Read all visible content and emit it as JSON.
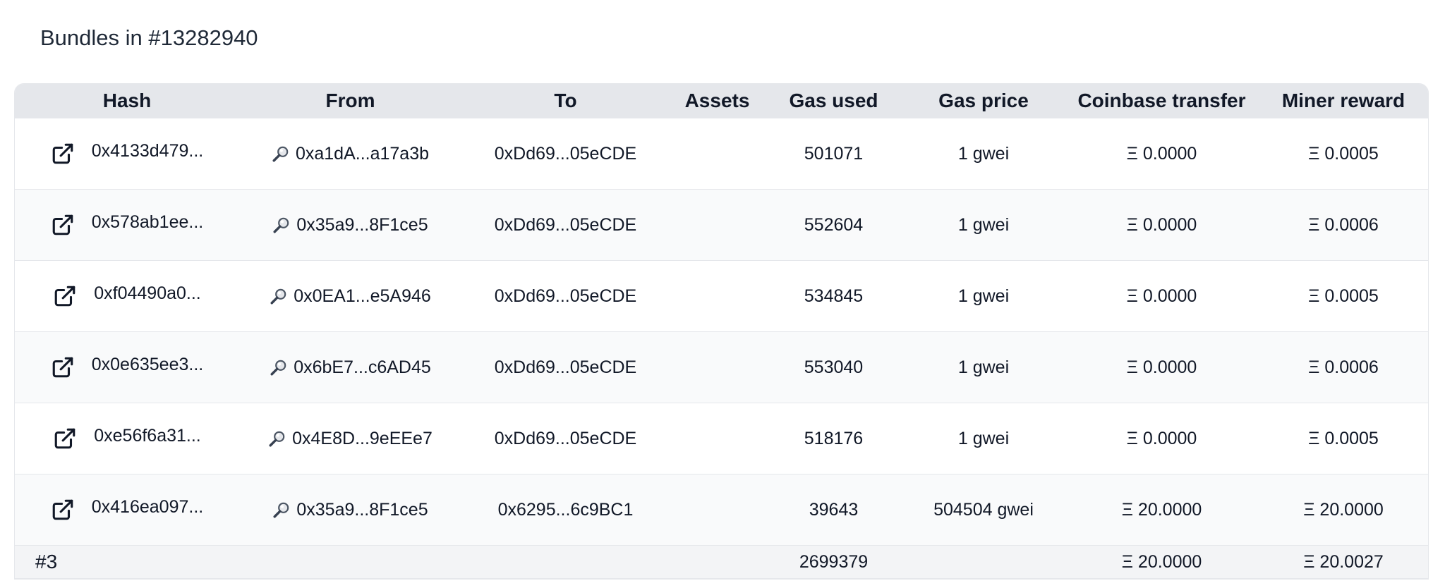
{
  "page": {
    "title": "Bundles in #13282940"
  },
  "table": {
    "headers": {
      "hash": "Hash",
      "from": "From",
      "to": "To",
      "assets": "Assets",
      "gas_used": "Gas used",
      "gas_price": "Gas price",
      "coinbase_transfer": "Coinbase transfer",
      "miner_reward": "Miner reward"
    },
    "rows": [
      {
        "hash": "0x4133d479...",
        "from": "0xa1dA...a17a3b",
        "to": "0xDd69...05eCDE",
        "assets": "",
        "gas_used": "501071",
        "gas_price": "1 gwei",
        "coinbase_transfer": "Ξ 0.0000",
        "miner_reward": "Ξ 0.0005"
      },
      {
        "hash": "0x578ab1ee...",
        "from": "0x35a9...8F1ce5",
        "to": "0xDd69...05eCDE",
        "assets": "",
        "gas_used": "552604",
        "gas_price": "1 gwei",
        "coinbase_transfer": "Ξ 0.0000",
        "miner_reward": "Ξ 0.0006"
      },
      {
        "hash": "0xf04490a0...",
        "from": "0x0EA1...e5A946",
        "to": "0xDd69...05eCDE",
        "assets": "",
        "gas_used": "534845",
        "gas_price": "1 gwei",
        "coinbase_transfer": "Ξ 0.0000",
        "miner_reward": "Ξ 0.0005"
      },
      {
        "hash": "0x0e635ee3...",
        "from": "0x6bE7...c6AD45",
        "to": "0xDd69...05eCDE",
        "assets": "",
        "gas_used": "553040",
        "gas_price": "1 gwei",
        "coinbase_transfer": "Ξ 0.0000",
        "miner_reward": "Ξ 0.0006"
      },
      {
        "hash": "0xe56f6a31...",
        "from": "0x4E8D...9eEEe7",
        "to": "0xDd69...05eCDE",
        "assets": "",
        "gas_used": "518176",
        "gas_price": "1 gwei",
        "coinbase_transfer": "Ξ 0.0000",
        "miner_reward": "Ξ 0.0005"
      },
      {
        "hash": "0x416ea097...",
        "from": "0x35a9...8F1ce5",
        "to": "0x6295...6c9BC1",
        "assets": "",
        "gas_used": "39643",
        "gas_price": "504504 gwei",
        "coinbase_transfer": "Ξ 20.0000",
        "miner_reward": "Ξ 20.0000"
      }
    ],
    "footer": {
      "label": "#3",
      "gas_used": "2699379",
      "coinbase_transfer": "Ξ 20.0000",
      "miner_reward": "Ξ 20.0027"
    }
  },
  "icons": {
    "hash_link": "external-link-icon",
    "from_search": "magnifying-glass-icon"
  }
}
